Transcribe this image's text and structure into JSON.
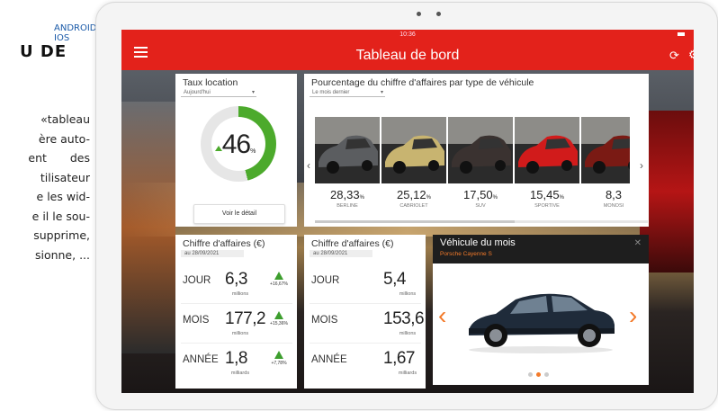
{
  "magazine": {
    "platforms": "ANDROID, IOS",
    "heading": "U DE",
    "body_lines": [
      "«tableau",
      "ère auto-",
      "ent des",
      "tilisateur",
      "e les wid-",
      "e il le sou-",
      "supprime,",
      "sionne, ..."
    ]
  },
  "status": {
    "clock": "10:36"
  },
  "app": {
    "title": "Tableau de bord",
    "menu_icon": "hamburger-menu-icon",
    "refresh_icon": "refresh-icon",
    "settings_icon": "gear-icon"
  },
  "taux_location": {
    "title": "Taux location",
    "select_value": "Aujourd'hui",
    "value": "46",
    "unit": "%",
    "fraction": 0.46,
    "button": "Voir le détail",
    "color": "#4caa2c"
  },
  "pourcentage": {
    "title": "Pourcentage du chiffre d'affaires par type de véhicule",
    "select_value": "Le mois dernier",
    "cars": [
      {
        "value": "28,33",
        "unit": "%",
        "label": "BERLINE",
        "color": "#5b5d60"
      },
      {
        "value": "25,12",
        "unit": "%",
        "label": "CABRIOLET",
        "color": "#c8b470"
      },
      {
        "value": "17,50",
        "unit": "%",
        "label": "SUV",
        "color": "#3a3230"
      },
      {
        "value": "15,45",
        "unit": "%",
        "label": "SPORTIVE",
        "color": "#d11b1b"
      },
      {
        "value": "8,3",
        "unit": "",
        "label": "MONOSI",
        "color": "#7a1a14"
      }
    ],
    "scroll_fraction": 0.6
  },
  "ca1": {
    "title": "Chiffre d'affaires (€)",
    "date": "au 28/09/2021",
    "rows": [
      {
        "label": "JOUR",
        "value": "6,3",
        "unit": "millions",
        "trend": "+16,67%"
      },
      {
        "label": "MOIS",
        "value": "177,2",
        "unit": "millions",
        "trend": "+15,36%"
      },
      {
        "label": "ANNÉE",
        "value": "1,8",
        "unit": "milliards",
        "trend": "+7,78%"
      }
    ]
  },
  "ca2": {
    "title": "Chiffre d'affaires (€)",
    "date": "au 28/09/2021",
    "rows": [
      {
        "label": "JOUR",
        "value": "5,4",
        "unit": "millions"
      },
      {
        "label": "MOIS",
        "value": "153,6",
        "unit": "millions"
      },
      {
        "label": "ANNÉE",
        "value": "1,67",
        "unit": "milliards"
      }
    ]
  },
  "vehicule_du_mois": {
    "title": "Véhicule du mois",
    "subtitle": "Porsche Cayenne S",
    "close_icon": "close-icon",
    "accent": "#f37a2a",
    "active_dot": 1,
    "dot_count": 3
  }
}
